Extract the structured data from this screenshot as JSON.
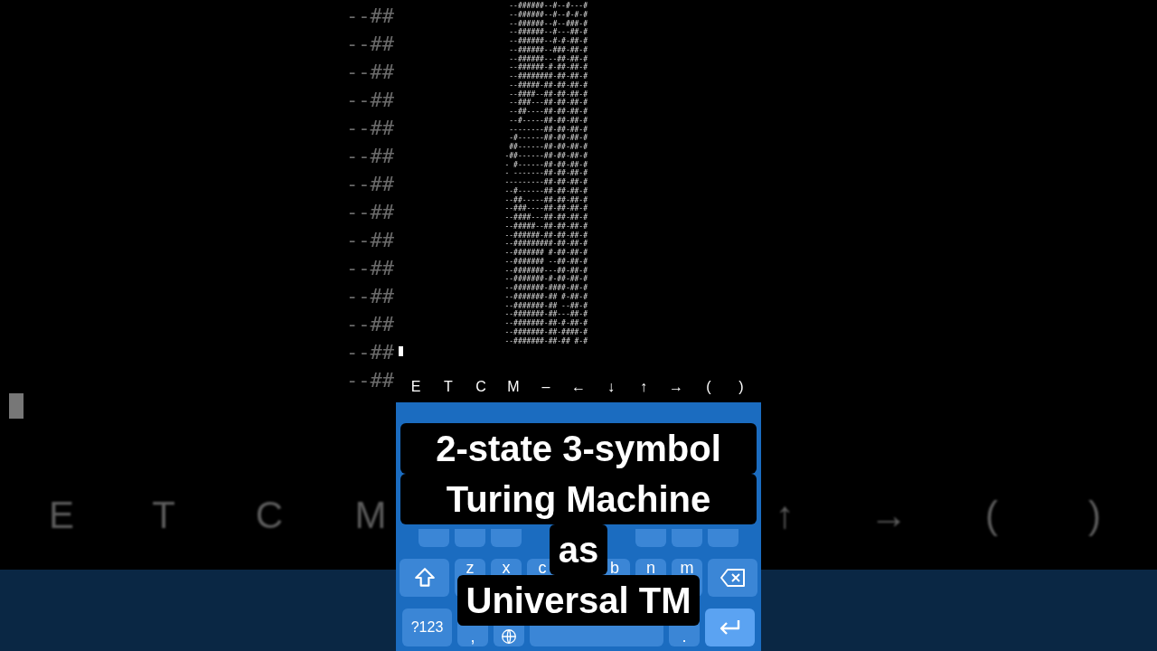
{
  "background": {
    "terminal_lines": [
      "--##",
      "--##",
      "--##",
      "--##",
      "--##",
      "--##",
      "--##",
      "--##",
      "--##",
      "--##",
      "--##",
      "--##",
      "--##",
      "--##"
    ],
    "extra_keys_left": [
      "E",
      "T",
      "C",
      "M"
    ],
    "extra_keys_right": [
      "↑",
      "→",
      "(",
      ")"
    ]
  },
  "terminal": {
    "lines": [
      "--######--#--#---#",
      "--######--#--#-#-#",
      "--######--#--###-#",
      "--######--#---##-#",
      "--######--#-#-##-#",
      "--######--###-##-#",
      "--######---##-##-#",
      "--######-#-##-##-#",
      "--########-##-##-#",
      "--#####-##-##-##-#",
      "--####--##-##-##-#",
      "--###---##-##-##-#",
      "--##----##-##-##-#",
      "--#-----##-##-##-#",
      "--------##-##-##-#",
      "-#------##-##-##-#",
      "##------##-##-##-#",
      "-##------##-##-##-#",
      "- #------##-##-##-#",
      "- -------##-##-##-#",
      "---------##-##-##-#",
      "--#------##-##-##-#",
      "--##-----##-##-##-#",
      "--###----##-##-##-#",
      "--####---##-##-##-#",
      "--#####--##-##-##-#",
      "--######-##-##-##-#",
      "--#########-##-##-#",
      "--####### #-##-##-#",
      "--####### --##-##-#",
      "--#######---##-##-#",
      "--#######-#-##-##-#",
      "--#######-####-##-#",
      "--#######-## #-##-#",
      "--#######-## --##-#",
      "--#######-##---##-#",
      "--#######-##-#-##-#",
      "--#######-##-####-#",
      "--#######-##-## #-#"
    ],
    "cursor": true
  },
  "extra_keys": [
    "E",
    "T",
    "C",
    "M",
    "–",
    "←",
    "↓",
    "↑",
    "→",
    "(",
    ")"
  ],
  "keyboard": {
    "rows": [
      [
        {
          "kind": "blank"
        },
        {
          "kind": "blank"
        },
        {
          "kind": "blank"
        },
        {
          "kind": "covered"
        },
        {
          "kind": "covered"
        },
        {
          "kind": "covered"
        },
        {
          "kind": "blank"
        },
        {
          "kind": "blank"
        },
        {
          "kind": "blank"
        }
      ],
      [
        {
          "kind": "shift"
        },
        {
          "kind": "letter",
          "label": "z"
        },
        {
          "kind": "letter",
          "label": "x"
        },
        {
          "kind": "letter",
          "label": "c"
        },
        {
          "kind": "covered"
        },
        {
          "kind": "letter",
          "label": "b"
        },
        {
          "kind": "letter",
          "label": "n"
        },
        {
          "kind": "letter",
          "label": "m"
        },
        {
          "kind": "backspace"
        }
      ],
      [
        {
          "kind": "symbols",
          "label": "?123"
        },
        {
          "kind": "mark",
          "label": ","
        },
        {
          "kind": "globe"
        },
        {
          "kind": "space"
        },
        {
          "kind": "mark",
          "label": "."
        },
        {
          "kind": "enter"
        }
      ]
    ]
  },
  "caption": [
    "2-state 3-symbol",
    "Turing Machine",
    "as",
    "Universal TM"
  ]
}
